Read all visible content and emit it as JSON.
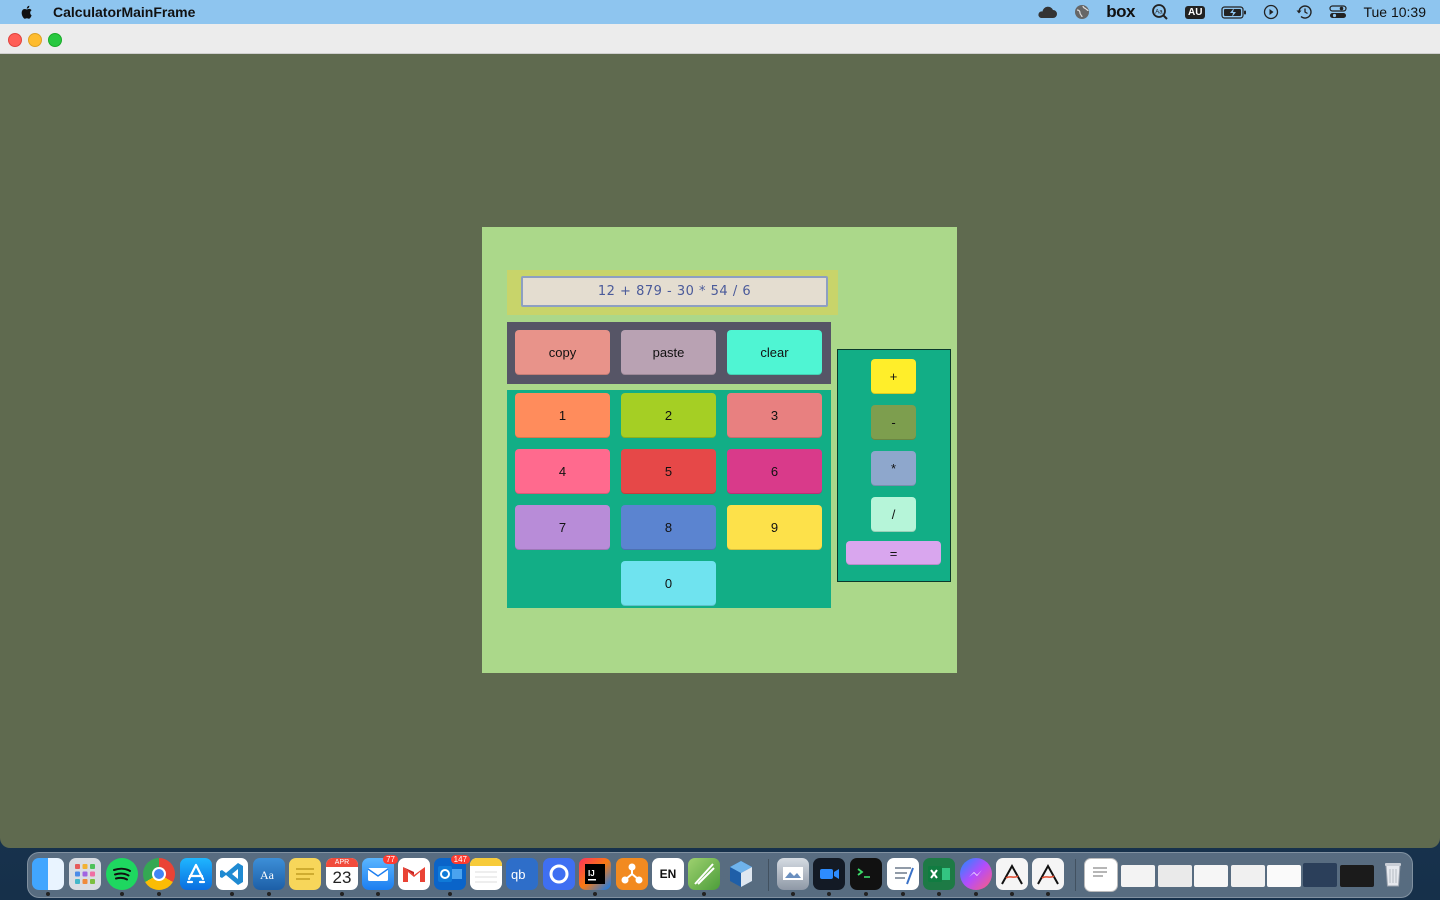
{
  "menubar": {
    "app_title": "CalculatorMainFrame",
    "box_label": "box",
    "au_label": "AU",
    "clock": "Tue 10:39",
    "status_icons": [
      "cloud-icon",
      "globe-icon",
      "box-icon",
      "dictionary-icon",
      "au-icon",
      "battery-icon",
      "play-icon",
      "time-machine-icon",
      "control-center-icon"
    ]
  },
  "calculator": {
    "expression": "12 + 879 - 30 * 54 / 6",
    "buttons": {
      "copy": "copy",
      "paste": "paste",
      "clear": "clear",
      "one": "1",
      "two": "2",
      "three": "3",
      "four": "4",
      "five": "5",
      "six": "6",
      "seven": "7",
      "eight": "8",
      "nine": "9",
      "zero": "0",
      "plus": "+",
      "minus": "-",
      "multiply": "*",
      "divide": "/",
      "equals": "="
    },
    "colors": {
      "window_bg": "#5f6a4f",
      "panel_bg": "#abd88a",
      "display_frame": "#c8d46a",
      "display_bg": "#e4ddd0",
      "util_panel": "#565566",
      "keypad_panel": "#12ae86",
      "copy": "#e8938a",
      "paste": "#b9a2b3",
      "clear": "#4ff5d3",
      "one": "#ff8c5c",
      "two": "#a5cf24",
      "three": "#e88080",
      "four": "#ff6a8e",
      "five": "#e64848",
      "six": "#d93a8a",
      "seven": "#b88cd8",
      "eight": "#5b84d0",
      "nine": "#fde14a",
      "zero": "#6fe3ef",
      "plus": "#ffee2a",
      "minus": "#7d9e4e",
      "multiply": "#8ea7cc",
      "divide": "#b6f5d9",
      "equals": "#d9a6ee"
    }
  },
  "dock": {
    "mail_badge": "77",
    "outlook_badge": "147",
    "calendar_month": "APR",
    "calendar_day": "23",
    "en_label": "EN",
    "apps": [
      "finder-icon",
      "launchpad-icon",
      "spotify-icon",
      "chrome-icon",
      "app-store-icon",
      "vscode-icon",
      "dictionary-icon",
      "stickies-icon",
      "calendar-icon",
      "mail-icon",
      "gmail-icon",
      "outlook-icon",
      "notes-icon",
      "qbittorrent-icon",
      "arc-icon",
      "intellij-icon",
      "sublime-merge-icon",
      "input-source-icon",
      "file-merge-icon",
      "virtualbox-icon",
      "preview-icon",
      "zoom-icon",
      "terminal-icon",
      "script-editor-icon",
      "excel-icon",
      "messenger-icon",
      "java-icon",
      "java-icon-2",
      "document-icon",
      "window-thumb-icon",
      "trash-icon"
    ]
  }
}
